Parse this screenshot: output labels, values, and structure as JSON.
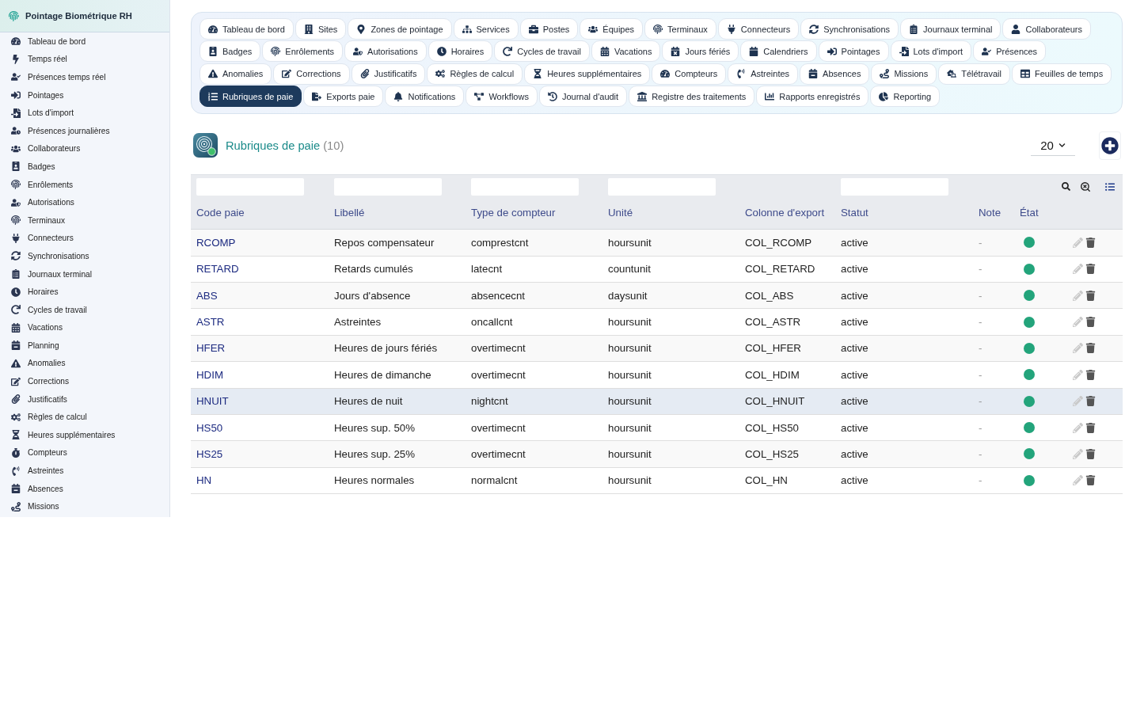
{
  "sidebar": {
    "title": "Pointage Biométrique RH",
    "items": [
      {
        "label": "Tableau de bord"
      },
      {
        "label": "Temps réel"
      },
      {
        "label": "Présences temps réel"
      },
      {
        "label": "Pointages"
      },
      {
        "label": "Lots d'import"
      },
      {
        "label": "Présences journalières"
      },
      {
        "label": "Collaborateurs"
      },
      {
        "label": "Badges"
      },
      {
        "label": "Enrôlements"
      },
      {
        "label": "Autorisations"
      },
      {
        "label": "Terminaux"
      },
      {
        "label": "Connecteurs"
      },
      {
        "label": "Synchronisations"
      },
      {
        "label": "Journaux terminal"
      },
      {
        "label": "Horaires"
      },
      {
        "label": "Cycles de travail"
      },
      {
        "label": "Vacations"
      },
      {
        "label": "Planning"
      },
      {
        "label": "Anomalies"
      },
      {
        "label": "Corrections"
      },
      {
        "label": "Justificatifs"
      },
      {
        "label": "Règles de calcul"
      },
      {
        "label": "Heures supplémentaires"
      },
      {
        "label": "Compteurs"
      },
      {
        "label": "Astreintes"
      },
      {
        "label": "Absences"
      },
      {
        "label": "Missions"
      }
    ]
  },
  "nav_tabs": {
    "rows": [
      [
        {
          "label": "Tableau de bord",
          "selected": false
        },
        {
          "label": "Sites",
          "selected": false
        },
        {
          "label": "Zones de pointage",
          "selected": false
        },
        {
          "label": "Services",
          "selected": false
        },
        {
          "label": "Postes",
          "selected": false
        },
        {
          "label": "Équipes",
          "selected": false
        },
        {
          "label": "Terminaux",
          "selected": false
        },
        {
          "label": "Connecteurs",
          "selected": false
        },
        {
          "label": "Synchronisations",
          "selected": false
        },
        {
          "label": "Journaux terminal",
          "selected": false
        },
        {
          "label": "Collaborateurs",
          "selected": false
        }
      ],
      [
        {
          "label": "Badges",
          "selected": false
        },
        {
          "label": "Enrôlements",
          "selected": false
        },
        {
          "label": "Autorisations",
          "selected": false
        },
        {
          "label": "Horaires",
          "selected": false
        },
        {
          "label": "Cycles de travail",
          "selected": false
        },
        {
          "label": "Vacations",
          "selected": false
        },
        {
          "label": "Jours fériés",
          "selected": false
        },
        {
          "label": "Calendriers",
          "selected": false
        },
        {
          "label": "Pointages",
          "selected": false
        },
        {
          "label": "Lots d'import",
          "selected": false
        },
        {
          "label": "Présences",
          "selected": false
        }
      ],
      [
        {
          "label": "Anomalies",
          "selected": false
        },
        {
          "label": "Corrections",
          "selected": false
        },
        {
          "label": "Justificatifs",
          "selected": false
        },
        {
          "label": "Règles de calcul",
          "selected": false
        },
        {
          "label": "Heures supplémentaires",
          "selected": false
        },
        {
          "label": "Compteurs",
          "selected": false
        },
        {
          "label": "Astreintes",
          "selected": false
        },
        {
          "label": "Absences",
          "selected": false
        },
        {
          "label": "Missions",
          "selected": false
        },
        {
          "label": "Télétravail",
          "selected": false
        },
        {
          "label": "Feuilles de temps",
          "selected": false
        }
      ],
      [
        {
          "label": "Rubriques de paie",
          "selected": true
        },
        {
          "label": "Exports paie",
          "selected": false
        },
        {
          "label": "Notifications",
          "selected": false
        },
        {
          "label": "Workflows",
          "selected": false
        },
        {
          "label": "Journal d'audit",
          "selected": false
        },
        {
          "label": "Registre des traitements",
          "selected": false
        },
        {
          "label": "Rapports enregistrés",
          "selected": false
        },
        {
          "label": "Reporting",
          "selected": false
        }
      ]
    ]
  },
  "page_header": {
    "title": "Rubriques de paie",
    "count": "(10)",
    "page_size": "20"
  },
  "table": {
    "columns": [
      {
        "label": "Code paie",
        "filterable": true
      },
      {
        "label": "Libellé",
        "filterable": true
      },
      {
        "label": "Type de compteur",
        "filterable": true
      },
      {
        "label": "Unité",
        "filterable": true
      },
      {
        "label": "Colonne d'export",
        "filterable": false
      },
      {
        "label": "Statut",
        "filterable": true
      },
      {
        "label": "Note",
        "filterable": false
      },
      {
        "label": "État",
        "filterable": false
      }
    ],
    "rows": [
      {
        "code": "RCOMP",
        "label": "Repos compensateur",
        "counter_type": "comprestcnt",
        "unit": "hoursunit",
        "export_column": "COL_RCOMP",
        "status": "active",
        "note": "-",
        "enabled": true,
        "selected": false
      },
      {
        "code": "RETARD",
        "label": "Retards cumulés",
        "counter_type": "latecnt",
        "unit": "countunit",
        "export_column": "COL_RETARD",
        "status": "active",
        "note": "-",
        "enabled": true,
        "selected": false
      },
      {
        "code": "ABS",
        "label": "Jours d'absence",
        "counter_type": "absencecnt",
        "unit": "daysunit",
        "export_column": "COL_ABS",
        "status": "active",
        "note": "-",
        "enabled": true,
        "selected": false
      },
      {
        "code": "ASTR",
        "label": "Astreintes",
        "counter_type": "oncallcnt",
        "unit": "hoursunit",
        "export_column": "COL_ASTR",
        "status": "active",
        "note": "-",
        "enabled": true,
        "selected": false
      },
      {
        "code": "HFER",
        "label": "Heures de jours fériés",
        "counter_type": "overtimecnt",
        "unit": "hoursunit",
        "export_column": "COL_HFER",
        "status": "active",
        "note": "-",
        "enabled": true,
        "selected": false
      },
      {
        "code": "HDIM",
        "label": "Heures de dimanche",
        "counter_type": "overtimecnt",
        "unit": "hoursunit",
        "export_column": "COL_HDIM",
        "status": "active",
        "note": "-",
        "enabled": true,
        "selected": false
      },
      {
        "code": "HNUIT",
        "label": "Heures de nuit",
        "counter_type": "nightcnt",
        "unit": "hoursunit",
        "export_column": "COL_HNUIT",
        "status": "active",
        "note": "-",
        "enabled": true,
        "selected": true
      },
      {
        "code": "HS50",
        "label": "Heures sup. 50%",
        "counter_type": "overtimecnt",
        "unit": "hoursunit",
        "export_column": "COL_HS50",
        "status": "active",
        "note": "-",
        "enabled": true,
        "selected": false
      },
      {
        "code": "HS25",
        "label": "Heures sup. 25%",
        "counter_type": "overtimecnt",
        "unit": "hoursunit",
        "export_column": "COL_HS25",
        "status": "active",
        "note": "-",
        "enabled": true,
        "selected": false
      },
      {
        "code": "HN",
        "label": "Heures normales",
        "counter_type": "normalcnt",
        "unit": "hoursunit",
        "export_column": "COL_HN",
        "status": "active",
        "note": "-",
        "enabled": true,
        "selected": false
      }
    ]
  }
}
